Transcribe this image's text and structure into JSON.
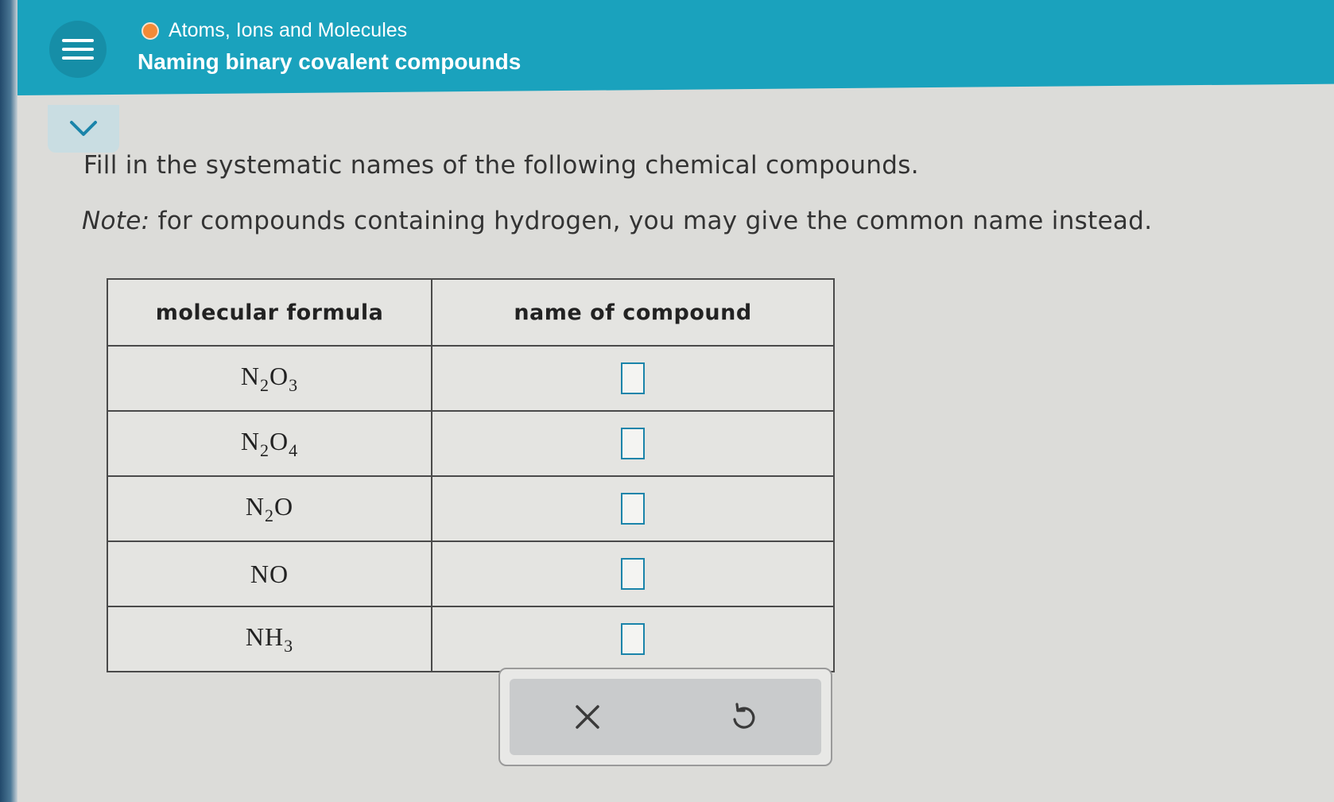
{
  "header": {
    "topic": "Atoms, Ions and Molecules",
    "title": "Naming binary covalent compounds",
    "topic_dot_color": "#f28a36",
    "bar_color": "#1aa2bd"
  },
  "icons": {
    "menu": "hamburger-menu-icon",
    "collapse": "chevron-down-icon",
    "clear": "close-icon",
    "reset": "undo-icon"
  },
  "question": {
    "instruction": "Fill in the systematic names of the following chemical compounds.",
    "note_label": "Note:",
    "note_text": " for compounds containing hydrogen, you may give the common name instead."
  },
  "table": {
    "headers": [
      "molecular formula",
      "name of compound"
    ],
    "rows": [
      {
        "formula": [
          {
            "el": "N",
            "n": "2"
          },
          {
            "el": "O",
            "n": "3"
          }
        ],
        "answer": ""
      },
      {
        "formula": [
          {
            "el": "N",
            "n": "2"
          },
          {
            "el": "O",
            "n": "4"
          }
        ],
        "answer": ""
      },
      {
        "formula": [
          {
            "el": "N",
            "n": "2"
          },
          {
            "el": "O",
            "n": ""
          }
        ],
        "answer": ""
      },
      {
        "formula": [
          {
            "el": "N",
            "n": ""
          },
          {
            "el": "O",
            "n": ""
          }
        ],
        "answer": ""
      },
      {
        "formula": [
          {
            "el": "N",
            "n": ""
          },
          {
            "el": "H",
            "n": "3"
          }
        ],
        "answer": ""
      }
    ]
  }
}
